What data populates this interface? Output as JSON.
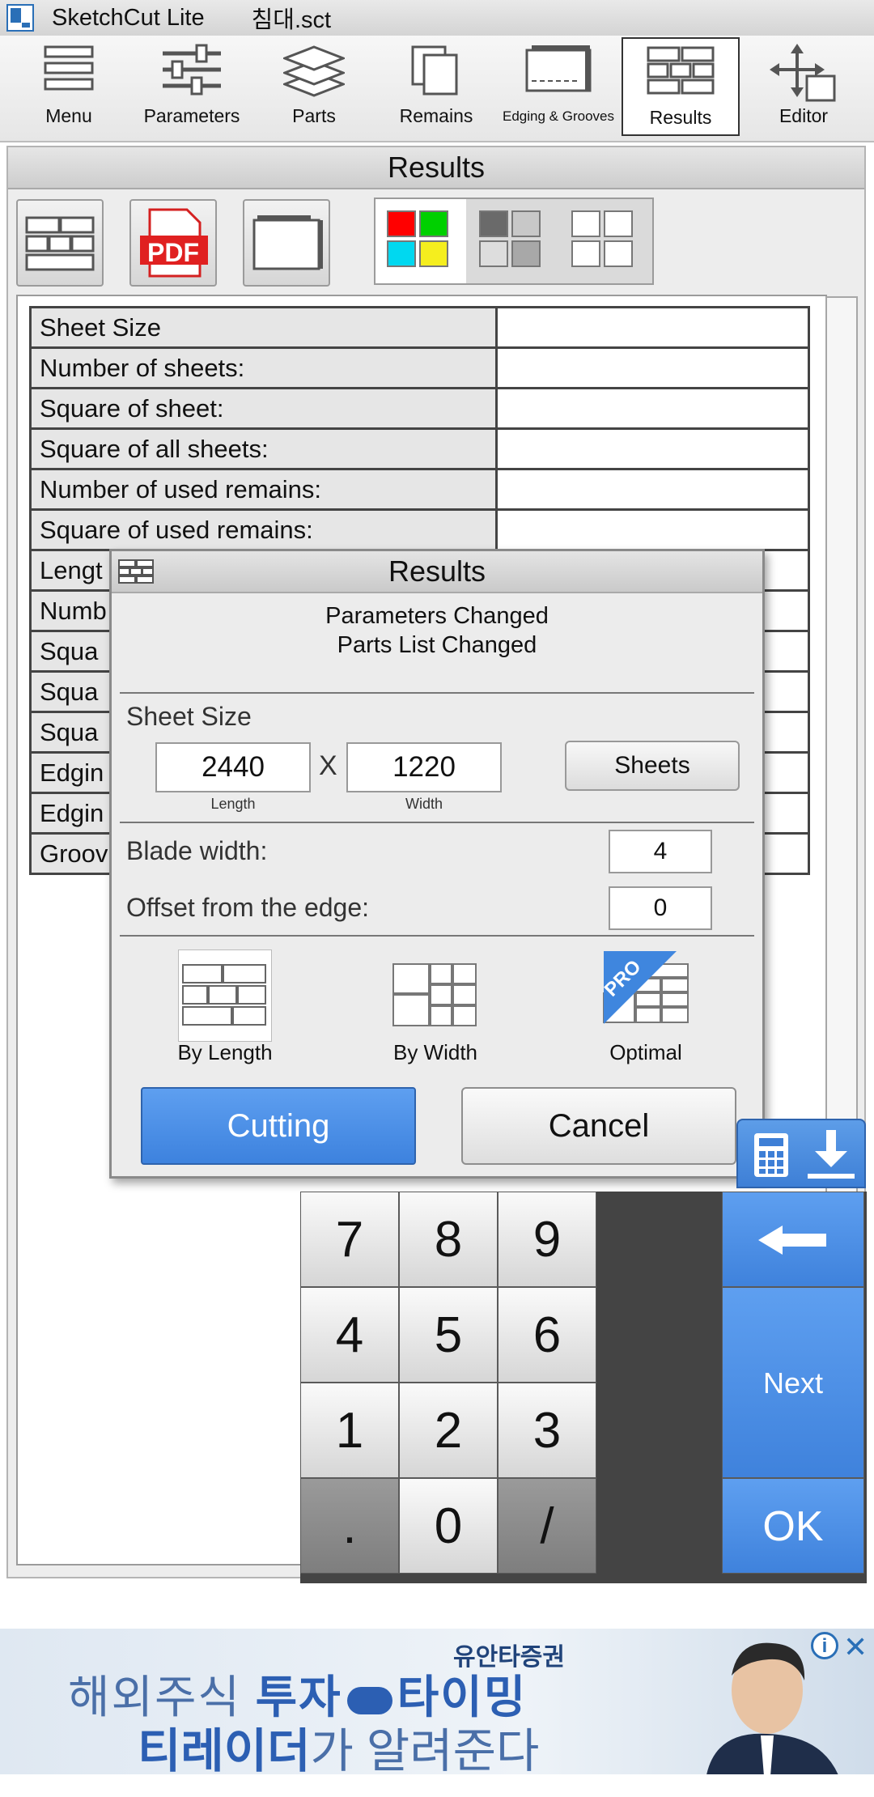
{
  "titlebar": {
    "app_name": "SketchCut Lite",
    "file_name": "침대.sct"
  },
  "toolbar": {
    "items": [
      {
        "label": "Menu"
      },
      {
        "label": "Parameters"
      },
      {
        "label": "Parts"
      },
      {
        "label": "Remains"
      },
      {
        "label": "Edging & Grooves"
      },
      {
        "label": "Results"
      },
      {
        "label": "Editor"
      }
    ],
    "active": "Results"
  },
  "panel": {
    "title": "Results",
    "pdf_label": "PDF",
    "rows": [
      {
        "label": "Sheet Size",
        "value": ""
      },
      {
        "label": "Number of sheets:",
        "value": ""
      },
      {
        "label": "Square of sheet:",
        "value": ""
      },
      {
        "label": "Square of all sheets:",
        "value": ""
      },
      {
        "label": "Number of used remains:",
        "value": ""
      },
      {
        "label": "Square of used remains:",
        "value": ""
      },
      {
        "label": "Lengt",
        "value": ""
      },
      {
        "label": "Numb",
        "value": ""
      },
      {
        "label": "Squa",
        "value": ""
      },
      {
        "label": "Squa",
        "value": ""
      },
      {
        "label": "Squa",
        "value": ""
      },
      {
        "label": "Edgin",
        "value": ""
      },
      {
        "label": "Edgin",
        "value": ""
      },
      {
        "label": "Groov",
        "value": ""
      }
    ]
  },
  "dialog": {
    "title": "Results",
    "message_line1": "Parameters Changed",
    "message_line2": "Parts List Changed",
    "sheet_size_label": "Sheet Size",
    "length_value": "2440",
    "x_sign": "X",
    "width_value": "1220",
    "length_caption": "Length",
    "width_caption": "Width",
    "sheets_button": "Sheets",
    "blade_width_label": "Blade width:",
    "blade_width_value": "4",
    "offset_label": "Offset from the edge:",
    "offset_value": "0",
    "options": [
      {
        "label": "By Length"
      },
      {
        "label": "By Width"
      },
      {
        "label": "Optimal",
        "badge": "PRO"
      }
    ],
    "cutting_button": "Cutting",
    "cancel_button": "Cancel"
  },
  "keypad": {
    "keys": [
      "7",
      "8",
      "9",
      "4",
      "5",
      "6",
      "1",
      "2",
      "3",
      ".",
      "0",
      "/"
    ],
    "next_label": "Next",
    "ok_label": "OK"
  },
  "ad": {
    "brand": "유안타증권",
    "line1_a": "해외주식 ",
    "line1_b": "투자",
    "line1_c": "타이밍",
    "line2_a": "티레이더",
    "line2_b": "가 알려준다",
    "info": "i",
    "close": "✕"
  },
  "colors": {
    "accent_blue": "#3d82de",
    "panel_bg": "#ededed",
    "table_label_bg": "#e6e6e6",
    "pdf_red": "#e02020"
  }
}
